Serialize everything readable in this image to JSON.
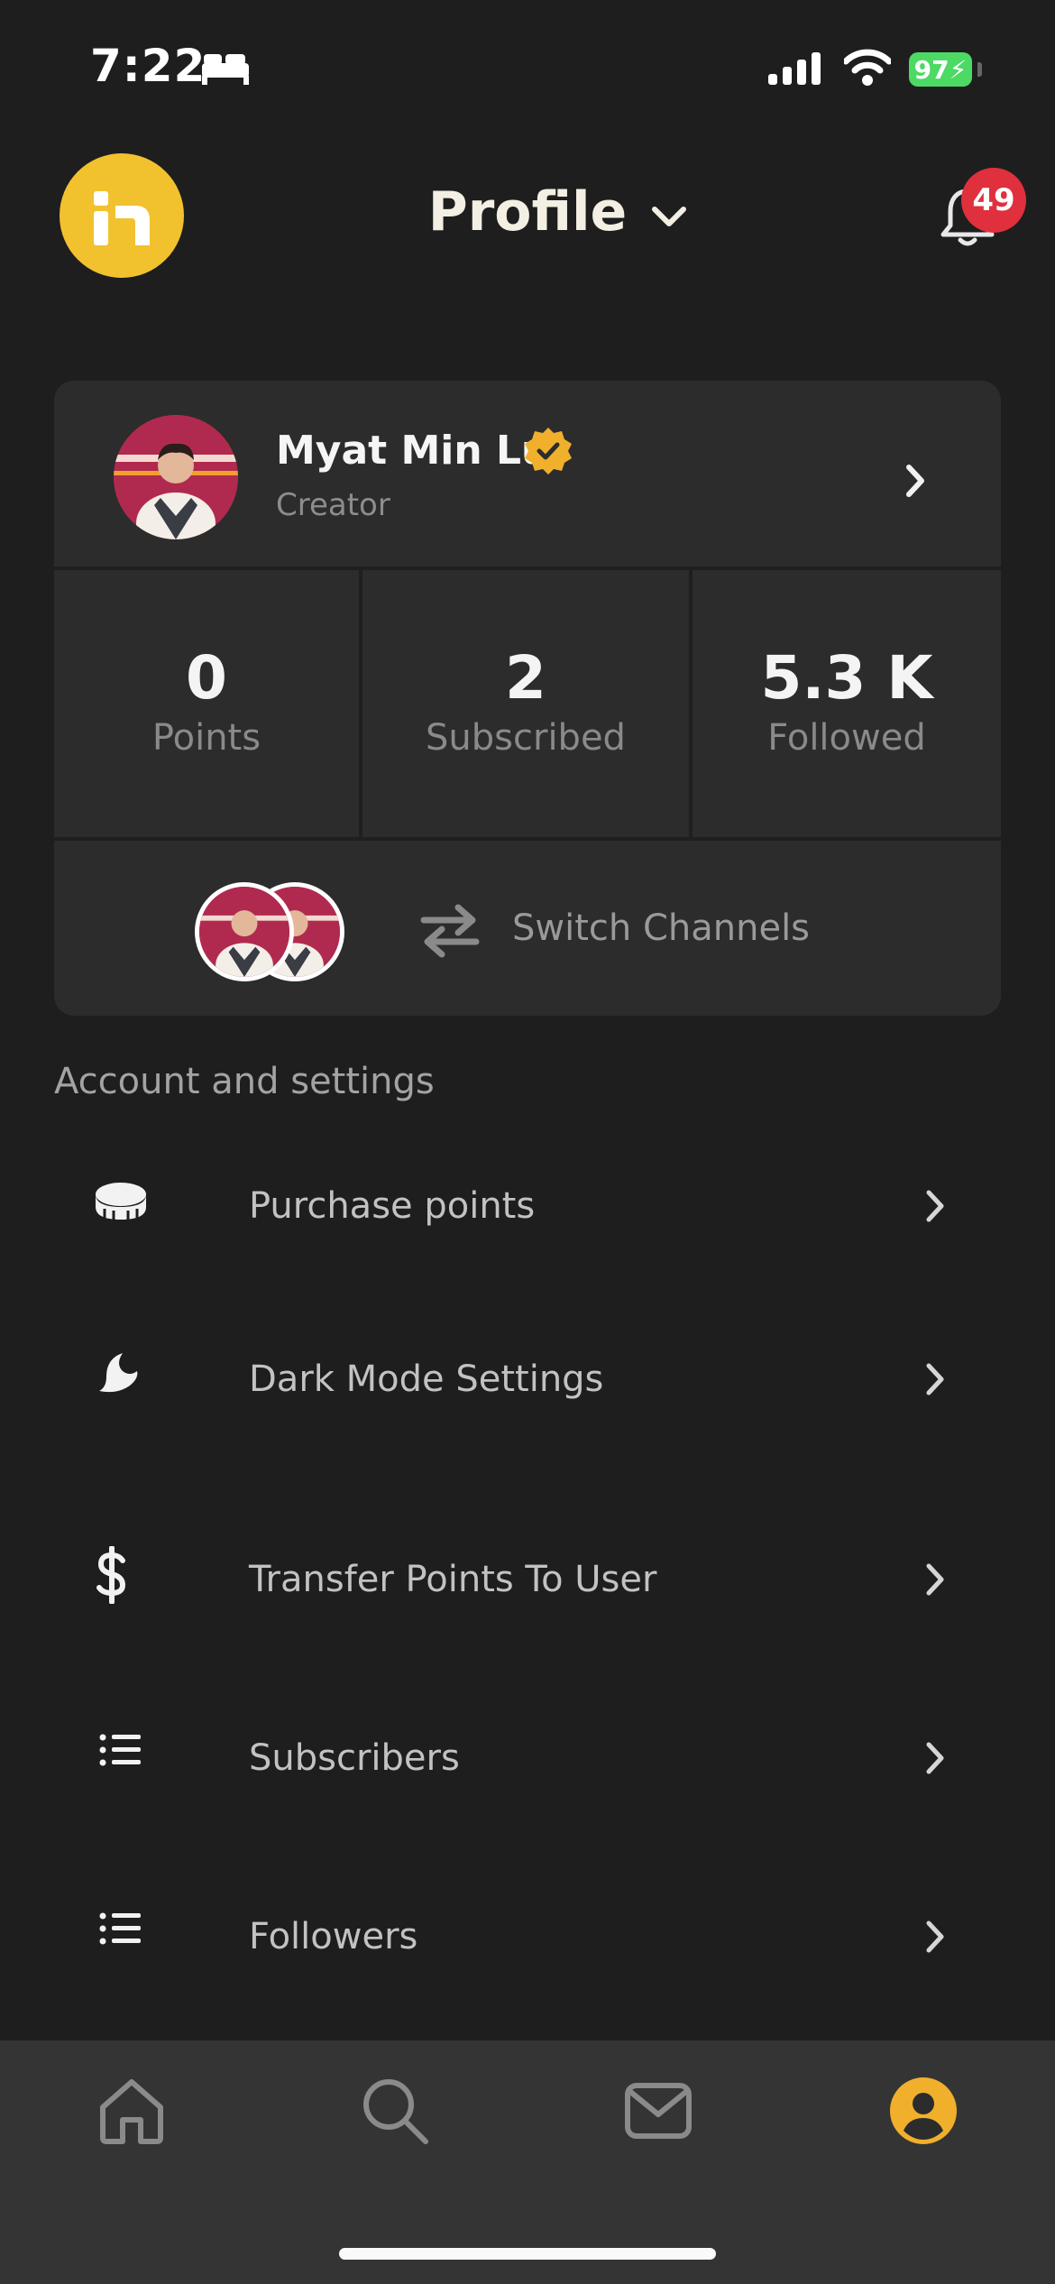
{
  "status_bar": {
    "time": "7:22",
    "battery": "97",
    "icons": [
      "bed-icon",
      "signal-icon",
      "wifi-icon",
      "battery-icon"
    ]
  },
  "header": {
    "title": "Profile",
    "notification_count": "49",
    "icons": [
      "app-logo",
      "chevron-down-icon",
      "bell-icon"
    ]
  },
  "profile": {
    "name": "Myat Min Lu",
    "role": "Creator",
    "stats": [
      {
        "value": "0",
        "label": "Points"
      },
      {
        "value": "2",
        "label": "Subscribed"
      },
      {
        "value": "5.3 K",
        "label": "Followed"
      }
    ],
    "switch_label": "Switch Channels"
  },
  "settings": {
    "section_title": "Account and settings",
    "items": [
      {
        "label": "Purchase points",
        "icon": "coin-icon"
      },
      {
        "label": "Dark Mode Settings",
        "icon": "moon-icon"
      },
      {
        "label": "Transfer Points To User",
        "icon": "dollar-icon"
      },
      {
        "label": "Subscribers",
        "icon": "list-icon"
      },
      {
        "label": "Followers",
        "icon": "list-icon"
      }
    ]
  },
  "bottom_nav": {
    "items": [
      "home-icon",
      "search-icon",
      "mail-icon",
      "profile-icon"
    ],
    "active": "profile-icon"
  },
  "colors": {
    "background": "#1e1e1f",
    "card": "#2c2c2d",
    "accent": "#f0b02c",
    "badge": "#e0303d",
    "battery": "#4cd964"
  }
}
